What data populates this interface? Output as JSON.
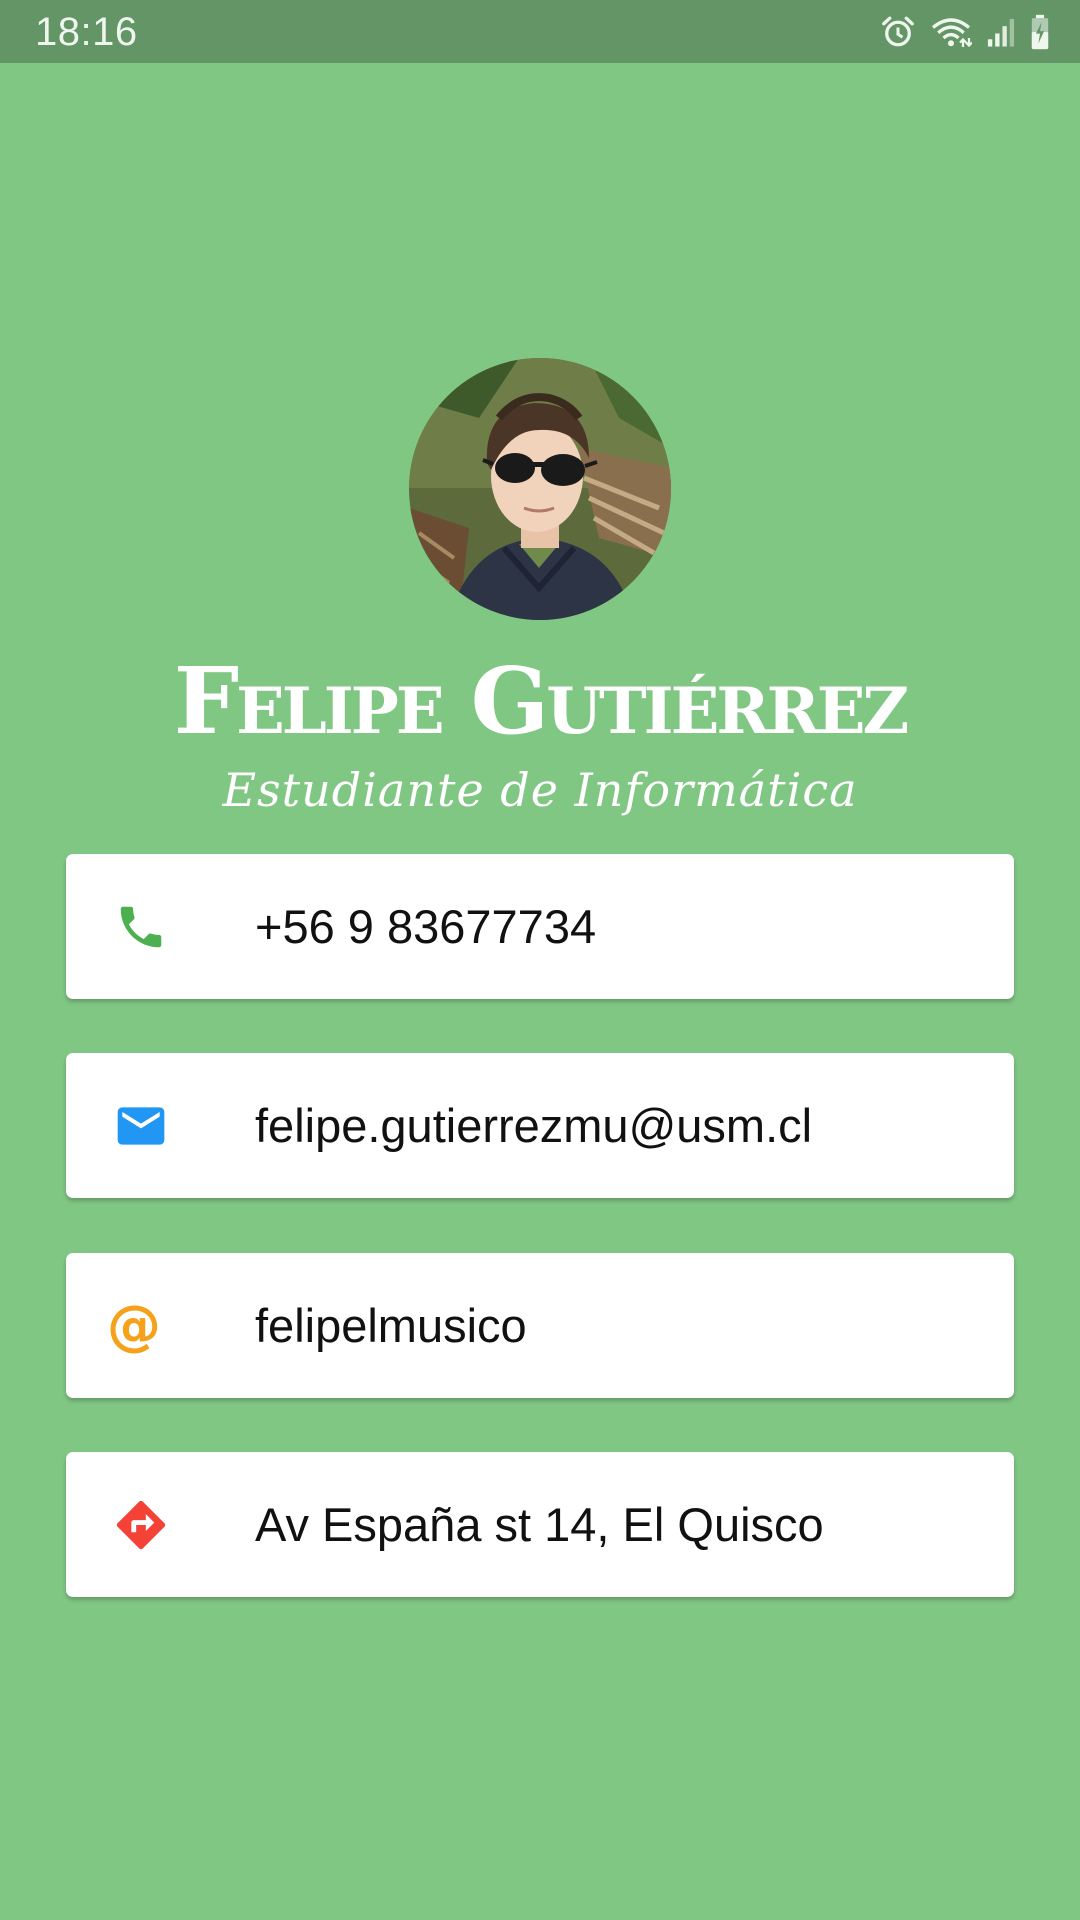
{
  "status_bar": {
    "time": "18:16",
    "icons": [
      "alarm-icon",
      "wifi-icon",
      "signal-icon",
      "battery-charging-icon"
    ]
  },
  "profile": {
    "name": "Felipe Gutiérrez",
    "subtitle": "Estudiante de Informática"
  },
  "contacts": [
    {
      "icon": "phone-icon",
      "icon_color": "#4caf50",
      "value": "+56 9 83677734"
    },
    {
      "icon": "email-icon",
      "icon_color": "#2196f3",
      "value": "felipe.gutierrezmu@usm.cl"
    },
    {
      "icon": "at-icon",
      "icon_color": "#f5a11a",
      "value": "felipelmusico",
      "glyph": "@"
    },
    {
      "icon": "directions-icon",
      "icon_color": "#f44336",
      "value": "Av España st 14, El Quisco"
    }
  ],
  "colors": {
    "background": "#81c784",
    "status_bar": "#639566",
    "card": "#ffffff"
  }
}
